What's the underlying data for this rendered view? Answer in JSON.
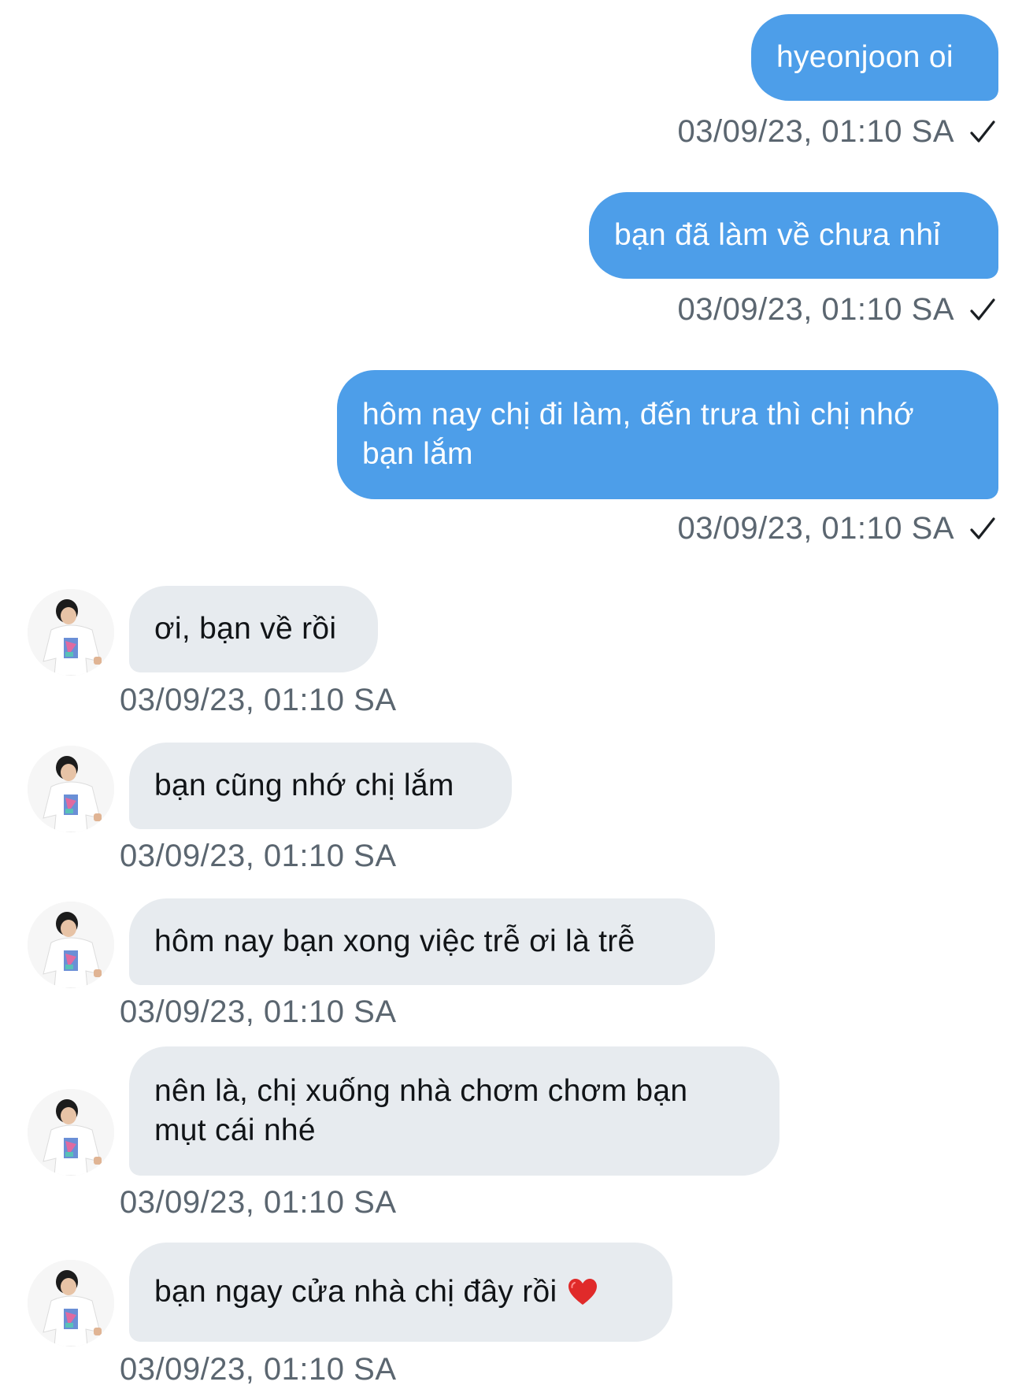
{
  "conversation": {
    "outgoing": [
      {
        "text": "hyeonjoon oi",
        "time": "03/09/23, 01:10 SA"
      },
      {
        "text": "bạn đã làm về chưa nhỉ",
        "time": "03/09/23, 01:10 SA"
      },
      {
        "text": "hôm nay chị đi làm, đến trưa thì chị nhớ bạn lắm",
        "time": "03/09/23, 01:10 SA"
      }
    ],
    "incoming": [
      {
        "text": "ơi, bạn về rồi",
        "time": "03/09/23, 01:10 SA"
      },
      {
        "text": "bạn cũng nhớ chị lắm",
        "time": "03/09/23, 01:10 SA"
      },
      {
        "text": "hôm nay bạn xong việc trễ ơi là trễ",
        "time": "03/09/23, 01:10 SA"
      },
      {
        "text": "nên là, chị xuống nhà chơm chơm bạn mụt cái nhé",
        "time": "03/09/23, 01:10 SA"
      },
      {
        "text": "bạn ngay cửa nhà chị đây rồi",
        "time": "03/09/23, 01:10 SA"
      }
    ]
  },
  "colors": {
    "outgoing_bubble": "#4d9ee9",
    "incoming_bubble": "#e7ebef",
    "timestamp": "#5b6670"
  },
  "icons": {
    "read_receipt": "checkmark-icon",
    "heart": "red-heart-icon",
    "avatar": "contact-avatar"
  }
}
